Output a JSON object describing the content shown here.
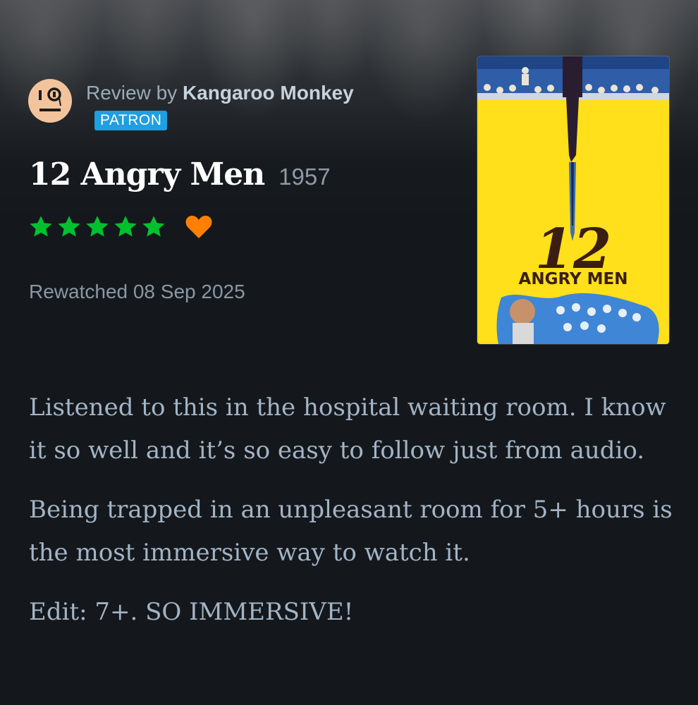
{
  "review": {
    "prefix": "Review by",
    "author": "Kangaroo Monkey",
    "badge": "PATRON",
    "avatar_icon": "monocle-face-avatar"
  },
  "film": {
    "title": "12 Angry Men",
    "year": "1957",
    "rating_stars": 5,
    "liked": true,
    "star_color": "#00c030",
    "heart_color": "#ff8000"
  },
  "watch": {
    "status": "Rewatched 08 Sep 2025"
  },
  "poster": {
    "title_number": "12",
    "title_words": "ANGRY MEN",
    "background_color": "#ffe01a"
  },
  "body": {
    "paragraphs": [
      "Listened to this in the hospital waiting room. I know it so well and it’s so easy to follow just from audio.",
      "Being trapped in an unpleasant room for 5+ hours is the most immersive way to watch it.",
      "Edit: 7+. SO IMMERSIVE!"
    ]
  }
}
